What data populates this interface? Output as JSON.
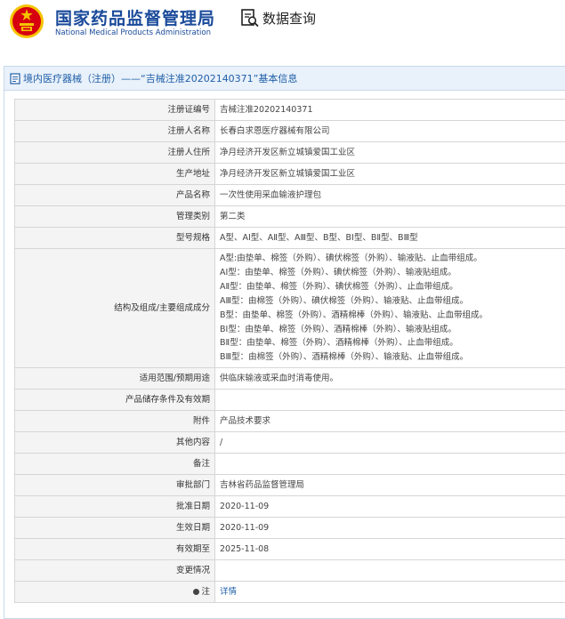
{
  "brand": {
    "name_cn": "国家药品监督管理局",
    "name_en": "National Medical Products Administration",
    "colors": {
      "primary": "#1a4a9a",
      "emblem_red": "#d7000f",
      "emblem_gold": "#f5c400"
    }
  },
  "query": {
    "label": "数据查询",
    "icon": "search-document-icon"
  },
  "panel": {
    "title": "境内医疗器械（注册）——“吉械注准20202140371”基本信息",
    "icon": "document-icon"
  },
  "rows": [
    {
      "label": "注册证编号",
      "value": "吉械注准20202140371"
    },
    {
      "label": "注册人名称",
      "value": "长春白求恩医疗器械有限公司"
    },
    {
      "label": "注册人住所",
      "value": "净月经济开发区新立城镇爱国工业区"
    },
    {
      "label": "生产地址",
      "value": "净月经济开发区新立城镇爱国工业区"
    },
    {
      "label": "产品名称",
      "value": "一次性使用采血输液护理包"
    },
    {
      "label": "管理类别",
      "value": "第二类"
    },
    {
      "label": "型号规格",
      "value": "A型、AⅠ型、AⅡ型、AⅢ型、B型、BⅠ型、BⅡ型、BⅢ型"
    },
    {
      "label": "结构及组成/主要组成成分",
      "lines": [
        "A型:由垫单、棉签（外购）、碘伏棉签（外购）、输液贴、止血带组成。",
        "AⅠ型：由垫单、棉签（外购）、碘伏棉签（外购）、输液贴组成。",
        "AⅡ型：由垫单、棉签（外购）、碘伏棉签（外购）、止血带组成。",
        "AⅢ型：由棉签（外购）、碘伏棉签（外购）、输液贴、止血带组成。",
        "B型：由垫单、棉签（外购）、酒精棉棒（外购）、输液贴、止血带组成。",
        "BⅠ型：由垫单、棉签（外购）、酒精棉棒（外购）、输液贴组成。",
        "BⅡ型：由垫单、棉签（外购）、酒精棉棒（外购）、止血带组成。",
        "BⅢ型：由棉签（外购）、酒精棉棒（外购）、输液贴、止血带组成。"
      ]
    },
    {
      "label": "适用范围/预期用途",
      "value": "供临床输液或采血时消毒使用。"
    },
    {
      "label": "产品储存条件及有效期",
      "value": ""
    },
    {
      "label": "附件",
      "value": "产品技术要求"
    },
    {
      "label": "其他内容",
      "value": "/"
    },
    {
      "label": "备注",
      "value": ""
    },
    {
      "label": "审批部门",
      "value": "吉林省药品监督管理局"
    },
    {
      "label": "批准日期",
      "value": "2020-11-09"
    },
    {
      "label": "生效日期",
      "value": "2020-11-09"
    },
    {
      "label": "有效期至",
      "value": "2025-11-08"
    },
    {
      "label": "变更情况",
      "value": ""
    },
    {
      "label": "注",
      "value": "详情",
      "link": true,
      "icon": "location-pin-icon"
    }
  ]
}
